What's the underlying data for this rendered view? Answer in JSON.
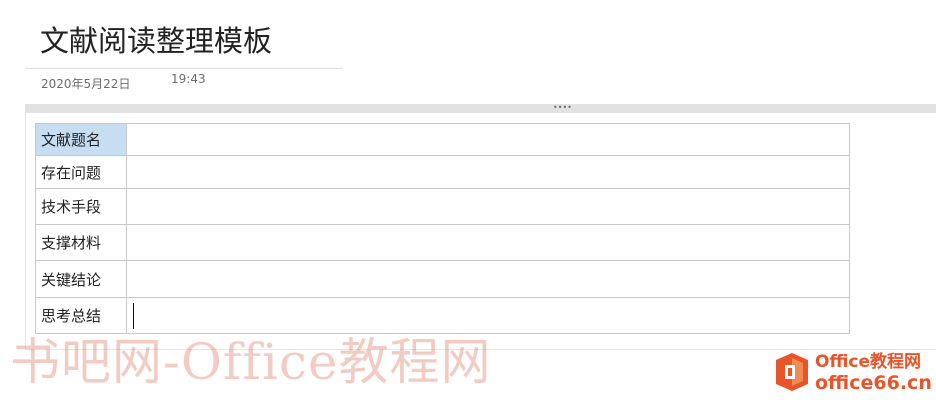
{
  "page": {
    "title": "文献阅读整理模板",
    "date": "2020年5月22日",
    "time": "19:43",
    "drag_handle": "••••"
  },
  "table": {
    "rows": [
      {
        "label": "文献题名",
        "value": ""
      },
      {
        "label": "存在问题",
        "value": ""
      },
      {
        "label": "技术手段",
        "value": ""
      },
      {
        "label": "支撑材料",
        "value": ""
      },
      {
        "label": "关键结论",
        "value": ""
      },
      {
        "label": "思考总结",
        "value": ""
      }
    ]
  },
  "watermark": {
    "text": "书吧网-Office教程网"
  },
  "logo": {
    "line1": "Office教程网",
    "line2": "office66.cn",
    "mark_letter": "O",
    "color": "#e8552a"
  },
  "colors": {
    "selected_cell": "#c6ddf2",
    "table_border": "#c8c8c8",
    "drag_bar": "#e2e2e2"
  }
}
